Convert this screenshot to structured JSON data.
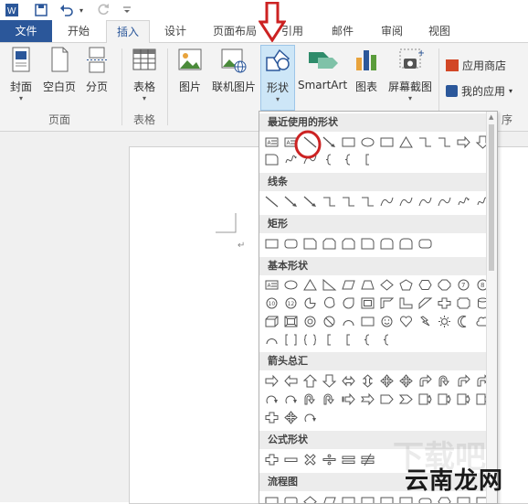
{
  "qat": {
    "word_icon": "word-logo-icon",
    "save_icon": "save-icon",
    "undo_icon": "undo-icon",
    "redo_icon": "redo-icon"
  },
  "tabs": [
    "文件",
    "开始",
    "插入",
    "设计",
    "页面布局",
    "引用",
    "邮件",
    "审阅",
    "视图"
  ],
  "active_tab": "插入",
  "ribbon": {
    "cover": "封面",
    "blank_page": "空白页",
    "page_break": "分页",
    "group_pages": "页面",
    "table": "表格",
    "group_table": "表格",
    "picture": "图片",
    "online_picture": "联机图片",
    "shapes": "形状",
    "smartart": "SmartArt",
    "chart": "图表",
    "screenshot": "屏幕截图",
    "app_store": "应用商店",
    "my_apps": "我的应用",
    "group_apps_fragment": "序"
  },
  "shapes_panel": {
    "sections": [
      "最近使用的形状",
      "线条",
      "矩形",
      "基本形状",
      "箭头总汇",
      "公式形状",
      "流程图"
    ],
    "row_counts": [
      [
        12,
        6
      ],
      [
        12
      ],
      [
        9
      ],
      [
        12,
        12,
        12,
        7
      ],
      [
        12,
        12,
        3
      ],
      [
        6
      ],
      [
        12
      ]
    ]
  },
  "watermark": "云南龙网",
  "colors": {
    "accent": "#2b579a",
    "highlight_red": "#cc2222"
  }
}
